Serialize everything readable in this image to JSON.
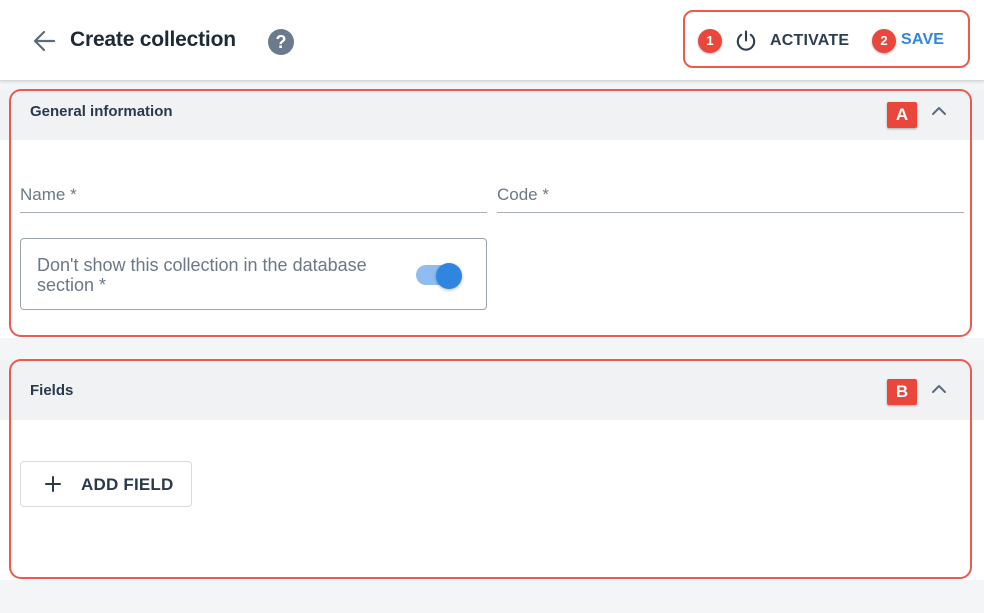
{
  "header": {
    "title": "Create collection",
    "help_label": "?",
    "activate_label": "ACTIVATE",
    "save_label": "SAVE",
    "badge_1": "1",
    "badge_2": "2"
  },
  "general": {
    "title": "General information",
    "badge": "A",
    "name_label": "Name *",
    "name_value": "",
    "code_label": "Code *",
    "code_value": "",
    "toggle_label": "Don't show this collection in the database section *",
    "toggle_on": true
  },
  "fields": {
    "title": "Fields",
    "badge": "B",
    "add_label": "ADD FIELD"
  },
  "colors": {
    "accent": "#2f86e0",
    "annotation": "#e9473b",
    "header_text": "#1f2a37",
    "section_bg": "#f1f2f4"
  },
  "icons": {
    "back": "arrow-left-icon",
    "help": "help-circle-icon",
    "power": "power-icon",
    "collapse": "chevron-up-icon",
    "add": "plus-icon"
  }
}
